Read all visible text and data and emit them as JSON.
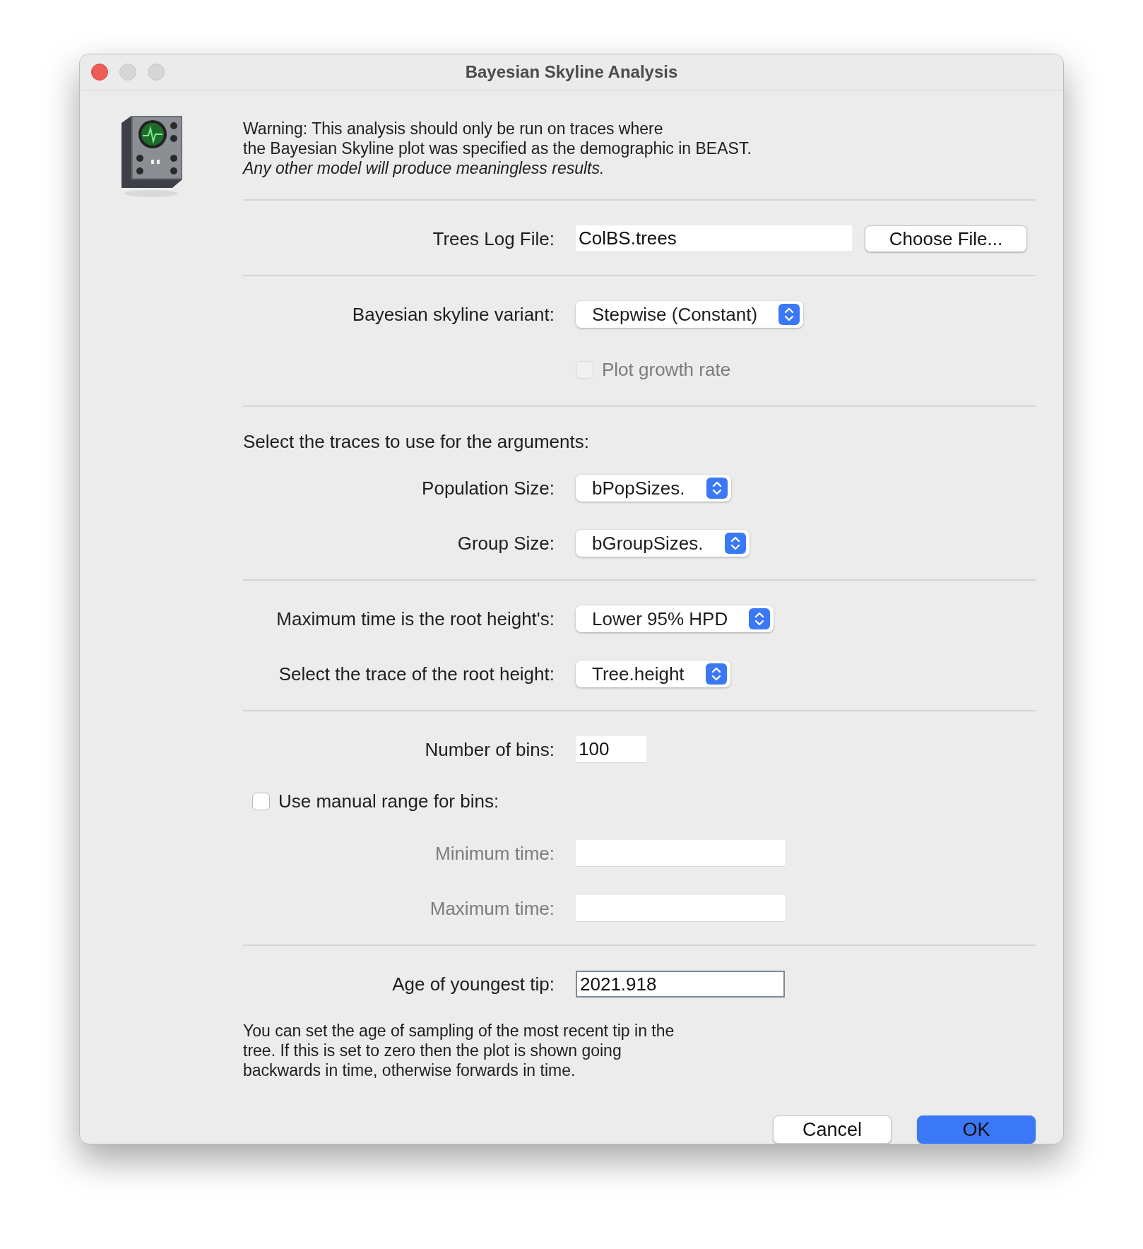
{
  "window": {
    "title": "Bayesian Skyline Analysis"
  },
  "warning": [
    {
      "text": "Warning: This analysis should only be run on traces where",
      "italic": false
    },
    {
      "text": "the Bayesian Skyline plot was specified as the demographic in BEAST.",
      "italic": false
    },
    {
      "text": "Any other model will produce meaningless results.",
      "italic": true
    }
  ],
  "sections": [
    {
      "rows": [
        {
          "kind": "file",
          "label": "Trees Log File:",
          "value": "ColBS.trees",
          "button": "Choose File..."
        }
      ]
    },
    {
      "rows": [
        {
          "kind": "select",
          "label": "Bayesian skyline variant:",
          "value": "Stepwise (Constant)"
        },
        {
          "kind": "option",
          "label": "Plot growth rate",
          "checked": false,
          "disabled": true
        }
      ]
    },
    {
      "rows": [
        {
          "kind": "heading",
          "label": "Select the traces to use for the arguments:"
        },
        {
          "kind": "select",
          "label": "Population Size:",
          "value": "bPopSizes."
        },
        {
          "kind": "select",
          "label": "Group Size:",
          "value": "bGroupSizes."
        }
      ]
    },
    {
      "rows": [
        {
          "kind": "select",
          "label": "Maximum time is the root height's:",
          "value": "Lower 95% HPD"
        },
        {
          "kind": "select",
          "label": "Select the trace of the root height:",
          "value": "Tree.height"
        }
      ]
    },
    {
      "rows": [
        {
          "kind": "short-field",
          "label": "Number of bins:",
          "value": "100",
          "disabled": false,
          "focused": false
        },
        {
          "kind": "checkbox",
          "label": "Use manual range for bins:",
          "checked": false,
          "disabled": false
        },
        {
          "kind": "field",
          "label": "Minimum time:",
          "disabled": true,
          "focused": false
        },
        {
          "kind": "field",
          "label": "Maximum time:",
          "disabled": true,
          "focused": false
        }
      ]
    },
    {
      "rows": [
        {
          "kind": "field",
          "label": "Age of youngest tip:",
          "value": "2021.918",
          "disabled": false,
          "focused": true
        },
        {
          "kind": "note",
          "label": "You can set the age of sampling of the most recent tip in the tree. If this is set to zero then the plot is shown going backwards in time, otherwise forwards in time."
        }
      ]
    }
  ],
  "buttons": [
    {
      "label": "Cancel",
      "default": false
    },
    {
      "label": "OK",
      "default": true
    }
  ]
}
